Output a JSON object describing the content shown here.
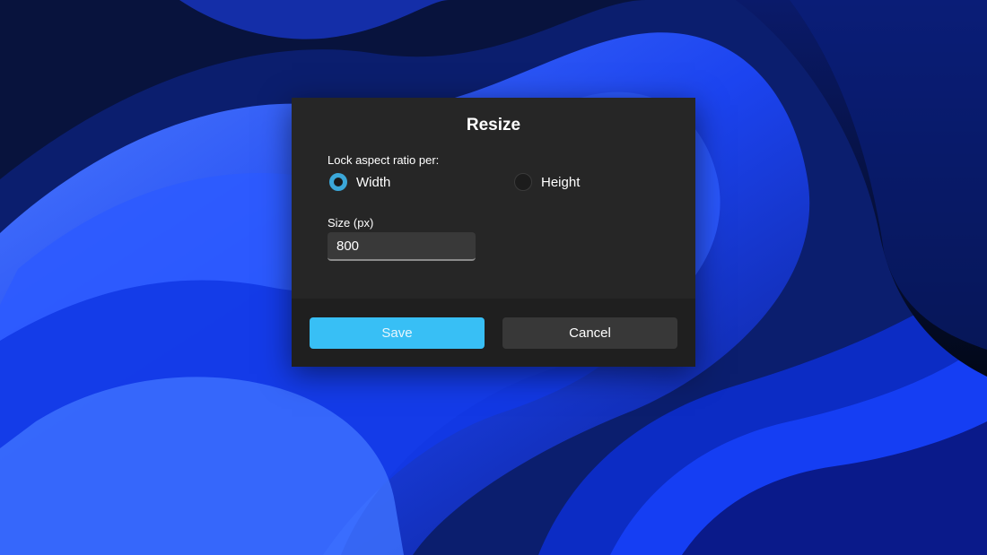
{
  "dialog": {
    "title": "Resize",
    "lock_label": "Lock aspect ratio per:",
    "options": [
      {
        "label": "Width",
        "checked": true
      },
      {
        "label": "Height",
        "checked": false
      }
    ],
    "size_label": "Size (px)",
    "size_value": "800",
    "save_label": "Save",
    "cancel_label": "Cancel"
  },
  "colors": {
    "accent": "#38bff5",
    "radio_checked": "#3ba7d8",
    "dialog_bg": "#262626",
    "footer_bg": "#1f1f1f"
  }
}
